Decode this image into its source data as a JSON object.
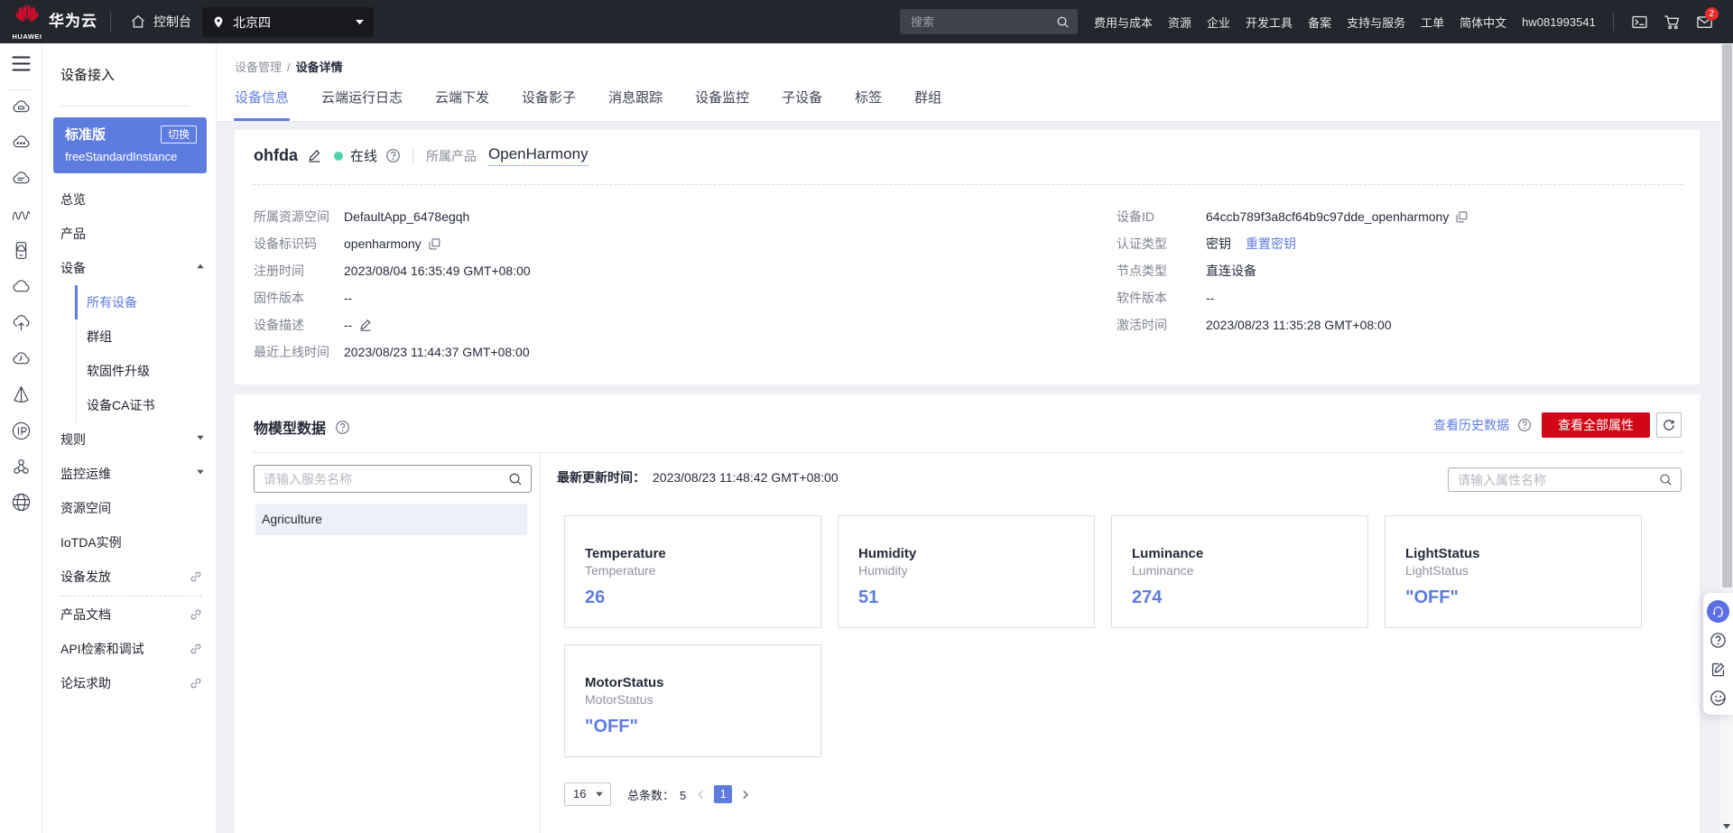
{
  "topbar": {
    "brand": "华为云",
    "brand_sub": "HUAWEI",
    "console_label": "控制台",
    "region": "北京四",
    "search_placeholder": "搜索",
    "nav_links": [
      "费用与成本",
      "资源",
      "企业",
      "开发工具",
      "备案",
      "支持与服务",
      "工单",
      "简体中文"
    ],
    "username": "hw081993541",
    "mail_badge": "2",
    "icons": [
      "console-terminal",
      "cart",
      "mail"
    ]
  },
  "rail": {
    "icons": [
      "cloud-server",
      "cloud-dots",
      "cloud-config",
      "waves",
      "device-cloud",
      "cloud",
      "cloud-upload",
      "cloud-sync",
      "prism",
      "ip-circle",
      "cluster",
      "globe"
    ]
  },
  "sidebar": {
    "title": "设备接入",
    "instance": {
      "edition": "标准版",
      "switch_label": "切换",
      "name": "freeStandardInstance"
    },
    "menu": [
      {
        "label": "总览"
      },
      {
        "label": "产品"
      },
      {
        "label": "设备",
        "caret": "up",
        "children": [
          "所有设备",
          "群组",
          "软固件升级",
          "设备CA证书"
        ],
        "active_child": "所有设备"
      },
      {
        "label": "规则",
        "caret": "down"
      },
      {
        "label": "监控运维",
        "caret": "down"
      },
      {
        "label": "资源空间"
      },
      {
        "label": "IoTDA实例"
      },
      {
        "label": "设备发放",
        "external": true
      },
      {
        "divider": true
      },
      {
        "label": "产品文档",
        "external": true
      },
      {
        "label": "API检索和调试",
        "external": true
      },
      {
        "label": "论坛求助",
        "external": true
      }
    ]
  },
  "breadcrumb": {
    "parent": "设备管理",
    "separator": "/",
    "current": "设备详情"
  },
  "tabs": {
    "active": "设备信息",
    "items": [
      "设备信息",
      "云端运行日志",
      "云端下发",
      "设备影子",
      "消息跟踪",
      "设备监控",
      "子设备",
      "标签",
      "群组"
    ]
  },
  "device": {
    "name": "ohfda",
    "status": "在线",
    "product_label": "所属产品",
    "product": "OpenHarmony",
    "fields_left": [
      {
        "label": "所属资源空间",
        "value": "DefaultApp_6478egqh"
      },
      {
        "label": "设备标识码",
        "value": "openharmony",
        "copy": true
      },
      {
        "label": "注册时间",
        "value": "2023/08/04 16:35:49 GMT+08:00"
      },
      {
        "label": "固件版本",
        "value": "--"
      },
      {
        "label": "设备描述",
        "value": "--",
        "edit": true
      },
      {
        "label": "最近上线时间",
        "value": "2023/08/23 11:44:37 GMT+08:00"
      }
    ],
    "fields_right": [
      {
        "label": "设备ID",
        "value": "64ccb789f3a8cf64b9c97dde_openharmony",
        "copy": true
      },
      {
        "label": "认证类型",
        "value": "密钥",
        "action": "重置密钥"
      },
      {
        "label": "节点类型",
        "value": "直连设备"
      },
      {
        "label": "软件版本",
        "value": "--"
      },
      {
        "label": "激活时间",
        "value": "2023/08/23 11:35:28 GMT+08:00"
      }
    ]
  },
  "model": {
    "title": "物模型数据",
    "history_link": "查看历史数据",
    "view_all_button": "查看全部属性",
    "service_search_placeholder": "请输入服务名称",
    "services": [
      {
        "name": "Agriculture",
        "selected": true
      }
    ],
    "updated_label": "最新更新时间：",
    "updated_value": "2023/08/23 11:48:42 GMT+08:00",
    "prop_search_placeholder": "请输入属性名称",
    "properties": [
      {
        "name": "Temperature",
        "desc": "Temperature",
        "value": "26"
      },
      {
        "name": "Humidity",
        "desc": "Humidity",
        "value": "51"
      },
      {
        "name": "Luminance",
        "desc": "Luminance",
        "value": "274"
      },
      {
        "name": "LightStatus",
        "desc": "LightStatus",
        "value": "\"OFF\""
      },
      {
        "name": "MotorStatus",
        "desc": "MotorStatus",
        "value": "\"OFF\""
      }
    ],
    "pagination": {
      "page_size": "16",
      "total_label": "总条数：",
      "total": "5",
      "current_page": "1"
    }
  },
  "colors": {
    "accent_blue": "#5e7ce0",
    "brand_red": "#d10717",
    "online_green": "#50d4ab",
    "topbar_bg": "#23262d",
    "page_bg": "#eef0f4"
  }
}
